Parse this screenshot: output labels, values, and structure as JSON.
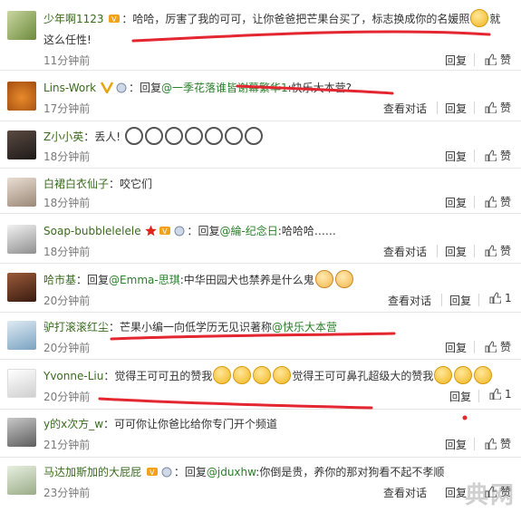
{
  "actions": {
    "reply": "回复",
    "like": "赞",
    "view_thread": "查看对话"
  },
  "comments": [
    {
      "user": "少年啊1123",
      "sep": "：",
      "text": "哈哈，厉害了我的可可，让你爸爸把芒果台买了，标志换成你的名媛照",
      "text_tail": "就这么任性!",
      "time": "11分钟前",
      "like_count": ""
    },
    {
      "user": "Lins-Work",
      "sep": "：",
      "reply_prefix": "回复",
      "mention": "@一季花落谁皆谢幕繁华1",
      "text": ":快乐大本营?",
      "time": "17分钟前",
      "like_count": ""
    },
    {
      "user": "Z小小英",
      "sep": "：",
      "text": "丢人!",
      "time": "18分钟前",
      "like_count": ""
    },
    {
      "user": "白裙白衣仙子",
      "sep": "：",
      "text": "咬它们",
      "time": "18分钟前",
      "like_count": ""
    },
    {
      "user": "Soap-bubblelelele",
      "sep": "：",
      "reply_prefix": "回复",
      "mention": "@綸-纪念日",
      "text": ":哈哈哈……",
      "time": "18分钟前",
      "like_count": ""
    },
    {
      "user": "哈市基",
      "sep": "：",
      "reply_prefix": "回复",
      "mention": "@Emma-思琪",
      "text": ":中华田园犬也禁养是什么鬼",
      "time": "20分钟前",
      "like_count": "1"
    },
    {
      "user": "驴打滚滚红尘",
      "sep": "：",
      "text": "芒果小编一向低学历无见识著称",
      "mention": "@快乐大本营",
      "time": "20分钟前",
      "like_count": ""
    },
    {
      "user": "Yvonne-Liu",
      "sep": "：",
      "text": "觉得王可可丑的赞我",
      "text_mid": "觉得王可可鼻孔超级大的赞我",
      "time": "20分钟前",
      "like_count": "1"
    },
    {
      "user": "y的x次方_w",
      "sep": "：",
      "text": "可可你让你爸比给你专门开个频道",
      "time": "21分钟前",
      "like_count": ""
    },
    {
      "user": "马达加斯加的大屁屁",
      "sep": "：",
      "reply_prefix": "回复",
      "mention": "@jduxhw",
      "text": ":你倒是贵，养你的那对狗看不起不孝顺",
      "time": "23分钟前",
      "like_count": ""
    }
  ],
  "watermark": {
    "text": "典网"
  },
  "colors": {
    "username": "#3a6b1e",
    "mention": "#2a7f2a",
    "underline": "#e3262f",
    "divider": "#e6e6e6"
  }
}
